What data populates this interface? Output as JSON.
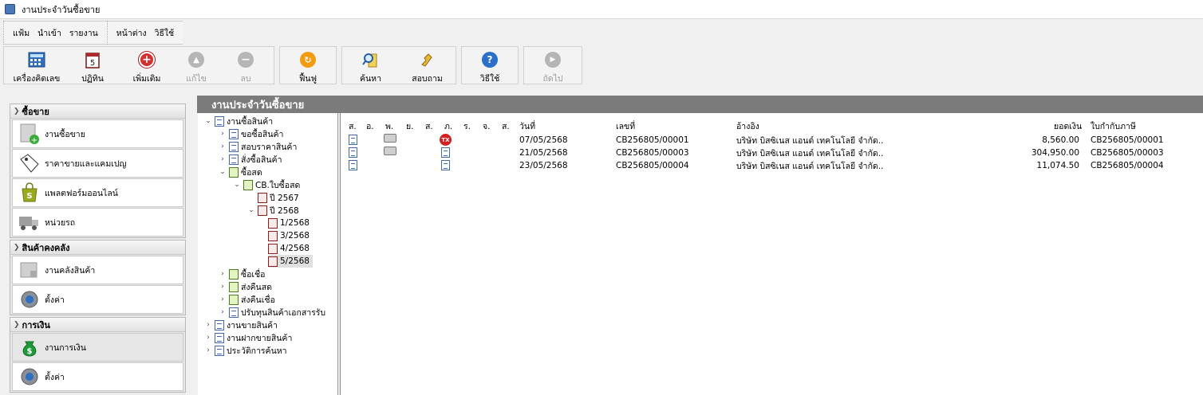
{
  "window": {
    "title": "งานประจำวันซื้อขาย"
  },
  "menu": {
    "group1": [
      "แฟ้ม",
      "นำเข้า",
      "รายงาน"
    ],
    "group2": [
      "หน้าต่าง",
      "วิธีใช้"
    ]
  },
  "toolbar": {
    "calculator": "เครื่องคิดเลข",
    "calendar": "ปฏิทิน",
    "add": "เพิ่มเติม",
    "edit": "แก้ไข",
    "delete": "ลบ",
    "restore": "ฟื้นฟู",
    "search": "ค้นหา",
    "inquiry": "สอบถาม",
    "help": "วิธีใช้",
    "next": "ถัดไป"
  },
  "sidebar": {
    "sections": [
      {
        "title": "ซื้อขาย",
        "items": [
          "งานซื้อขาย",
          "ราคาขายและแคมเปญ",
          "แพลตฟอร์มออนไลน์",
          "หน่วยรถ"
        ]
      },
      {
        "title": "สินค้าคงคลัง",
        "items": [
          "งานคลังสินค้า",
          "ตั้งค่า"
        ]
      },
      {
        "title": "การเงิน",
        "items": [
          "งานการเงิน",
          "ตั้งค่า"
        ]
      }
    ]
  },
  "main": {
    "title": "งานประจำวันซื้อขาย"
  },
  "tree": [
    "งานซื้อสินค้า",
    "ขอซื้อสินค้า",
    "สอบราคาสินค้า",
    "สั่งซื้อสินค้า",
    "ซื้อสด",
    "CB.ใบซื้อสด",
    "ปี 2567",
    "ปี 2568",
    "1/2568",
    "3/2568",
    "4/2568",
    "5/2568",
    "ซื้อเชื่อ",
    "ส่งคืนสด",
    "ส่งคืนเชื่อ",
    "ปรับทุนสินค้าเอกสารรับ",
    "งานขายสินค้า",
    "งานฝากขายสินค้า",
    "ประวัติการค้นหา"
  ],
  "list": {
    "columns": [
      "ส.",
      "อ.",
      "พ.",
      "ย.",
      "ส.",
      "ภ.",
      "ร.",
      "จ.",
      "ส.",
      "วันที่",
      "เลขที่",
      "อ้างอิง",
      "ยอดเงิน",
      "ใบกำกับภาษี"
    ],
    "rows": [
      {
        "date": "07/05/2568",
        "number": "CB256805/00001",
        "ref": "บริษัท บิสซิเนส แอนด์ เทคโนโลยี จำกัด..",
        "amount": "8,560.00",
        "tax": "CB256805/00001"
      },
      {
        "date": "21/05/2568",
        "number": "CB256805/00003",
        "ref": "บริษัท บิสซิเนส แอนด์ เทคโนโลยี จำกัด..",
        "amount": "304,950.00",
        "tax": "CB256805/00003"
      },
      {
        "date": "23/05/2568",
        "number": "CB256805/00004",
        "ref": "บริษัท บิสซิเนส แอนด์ เทคโนโลยี จำกัด..",
        "amount": "11,074.50",
        "tax": "CB256805/00004"
      }
    ]
  },
  "colors": {
    "header_bar": "#7b7b7b",
    "tx_badge": "#d42020",
    "add": "#d32f2f",
    "restore": "#f39c12",
    "help": "#2a6fc9"
  }
}
